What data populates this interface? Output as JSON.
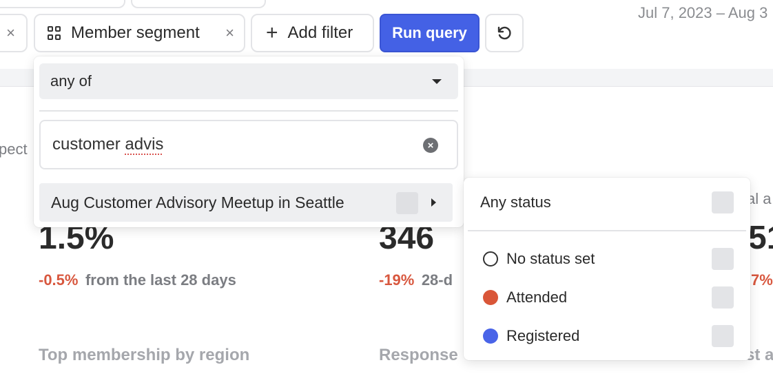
{
  "toolbar": {
    "segment_chip_label": "Member segment",
    "remove_glyph": "×",
    "add_filter_label": "Add filter",
    "add_glyph": "+",
    "run_query_label": "Run query",
    "date_range": "Jul 7, 2023 – Aug 3"
  },
  "background": {
    "left_fragment": "pect",
    "right_fragment": "al a",
    "metric1_value": "1.5%",
    "metric1_delta": "-0.5%",
    "metric1_note": "from the last 28 days",
    "metric2_value": "346",
    "metric2_delta": "-19%",
    "metric2_note": "28-d",
    "metric3_value": "51",
    "metric3_delta": "7%",
    "section1_label": "Top membership by region",
    "section2_label": "Response",
    "section3_fragment": "st a"
  },
  "filter_panel": {
    "match_mode": "any of",
    "search_value_prefix": "customer ",
    "search_value_misspelled": "advis",
    "clear_glyph": "×",
    "results": [
      {
        "label": "Aug Customer Advisory Meetup in Seattle"
      }
    ]
  },
  "status_submenu": {
    "any_status_label": "Any status",
    "statuses": [
      {
        "label": "No status set",
        "color": "#ffffff"
      },
      {
        "label": "Attended",
        "color": "#d95638"
      },
      {
        "label": "Registered",
        "color": "#4964e8"
      }
    ]
  },
  "colors": {
    "accent": "#4461e5",
    "negative_delta": "#d8573e"
  },
  "icons": {
    "segment": "grid-icon",
    "remove": "close-icon",
    "add": "plus-icon",
    "reset": "refresh-icon",
    "dropdown_caret": "caret-down-icon",
    "submenu_caret": "caret-right-icon",
    "clear": "clear-icon"
  }
}
